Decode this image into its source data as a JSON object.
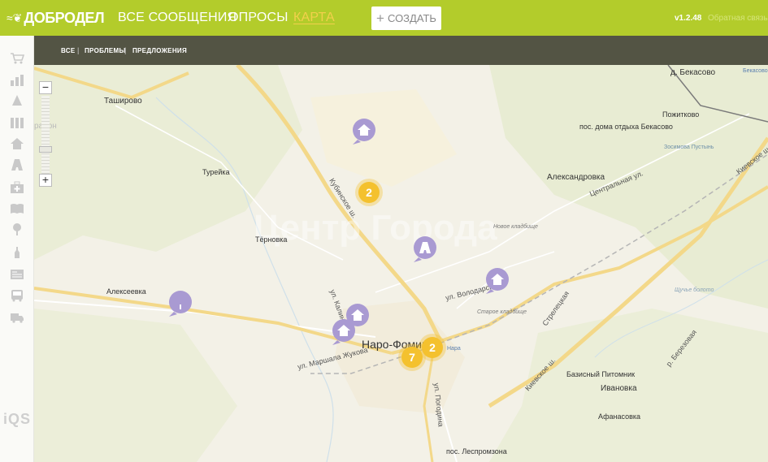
{
  "header": {
    "logo_text": "ДОБРОДЕЛ",
    "nav": [
      {
        "label": "ВСЕ СООБЩЕНИЯ"
      },
      {
        "label": "ОПРОСЫ"
      },
      {
        "label": "КАРТА"
      }
    ],
    "create_label": "СОЗДАТЬ",
    "version": "v1.2.48",
    "feedback": "Обратная связь"
  },
  "subnav": {
    "all": "ВСЕ",
    "problems": "ПРОБЛЕМЫ",
    "proposals": "ПРЕДЛОЖЕНИЯ"
  },
  "sidebar": {
    "icons": [
      "cart-icon",
      "bar-chart-icon",
      "road-cone-icon",
      "buildings-icon",
      "home-icon",
      "road-icon",
      "medkit-icon",
      "book-icon",
      "tree-icon",
      "bottle-icon",
      "newspaper-icon",
      "bus-icon",
      "truck-icon"
    ],
    "logo": "iQS"
  },
  "map": {
    "places": {
      "tashirovo": "Таширово",
      "tureyka": "Турейка",
      "ternovka": "Тёрновка",
      "alekseevka": "Алексеевка",
      "naro_fominsk": "Наро-Фоминск",
      "bekasovo": "д. Бекасово",
      "bekasovo_station": "Бекасово",
      "pozhitkovo": "Пожитково",
      "rest_house": "пос. дома отдыха Бекасово",
      "zosimova": "Зосимова Пустынь",
      "aleksandrovka": "Александровка",
      "nursery": "Базисный Питомник",
      "ivanovka": "Ивановка",
      "afanasovka": "Афанасовка",
      "lesopromzona": "пос. Леспромзона",
      "district": "район",
      "new_cemetery": "Новое кладбище",
      "old_cemetery": "Старое кладбище",
      "shchuche": "Щучье болото",
      "nara": "Нара"
    },
    "streets": {
      "kubinskoe": "Кубинское ш.",
      "marshala": "ул. Маршала Жукова",
      "volodarskogo": "ул. Володарского",
      "kievskoe1": "Киевское ш.",
      "kievskoe2": "Киевское ш.",
      "centralnaya": "Центральная ул.",
      "pogodina": "ул. Погодина",
      "kalinina": "ул. Калинина",
      "berezovaya": "р. Березовая",
      "streleckaya": "Стрелецкая"
    },
    "clusters": [
      {
        "count": "2"
      },
      {
        "count": "2"
      },
      {
        "count": "7"
      }
    ],
    "markers": [
      "home-icon",
      "home-icon",
      "home-icon",
      "home-icon",
      "road-icon",
      "tree-icon"
    ],
    "watermark": "Центр Города"
  }
}
